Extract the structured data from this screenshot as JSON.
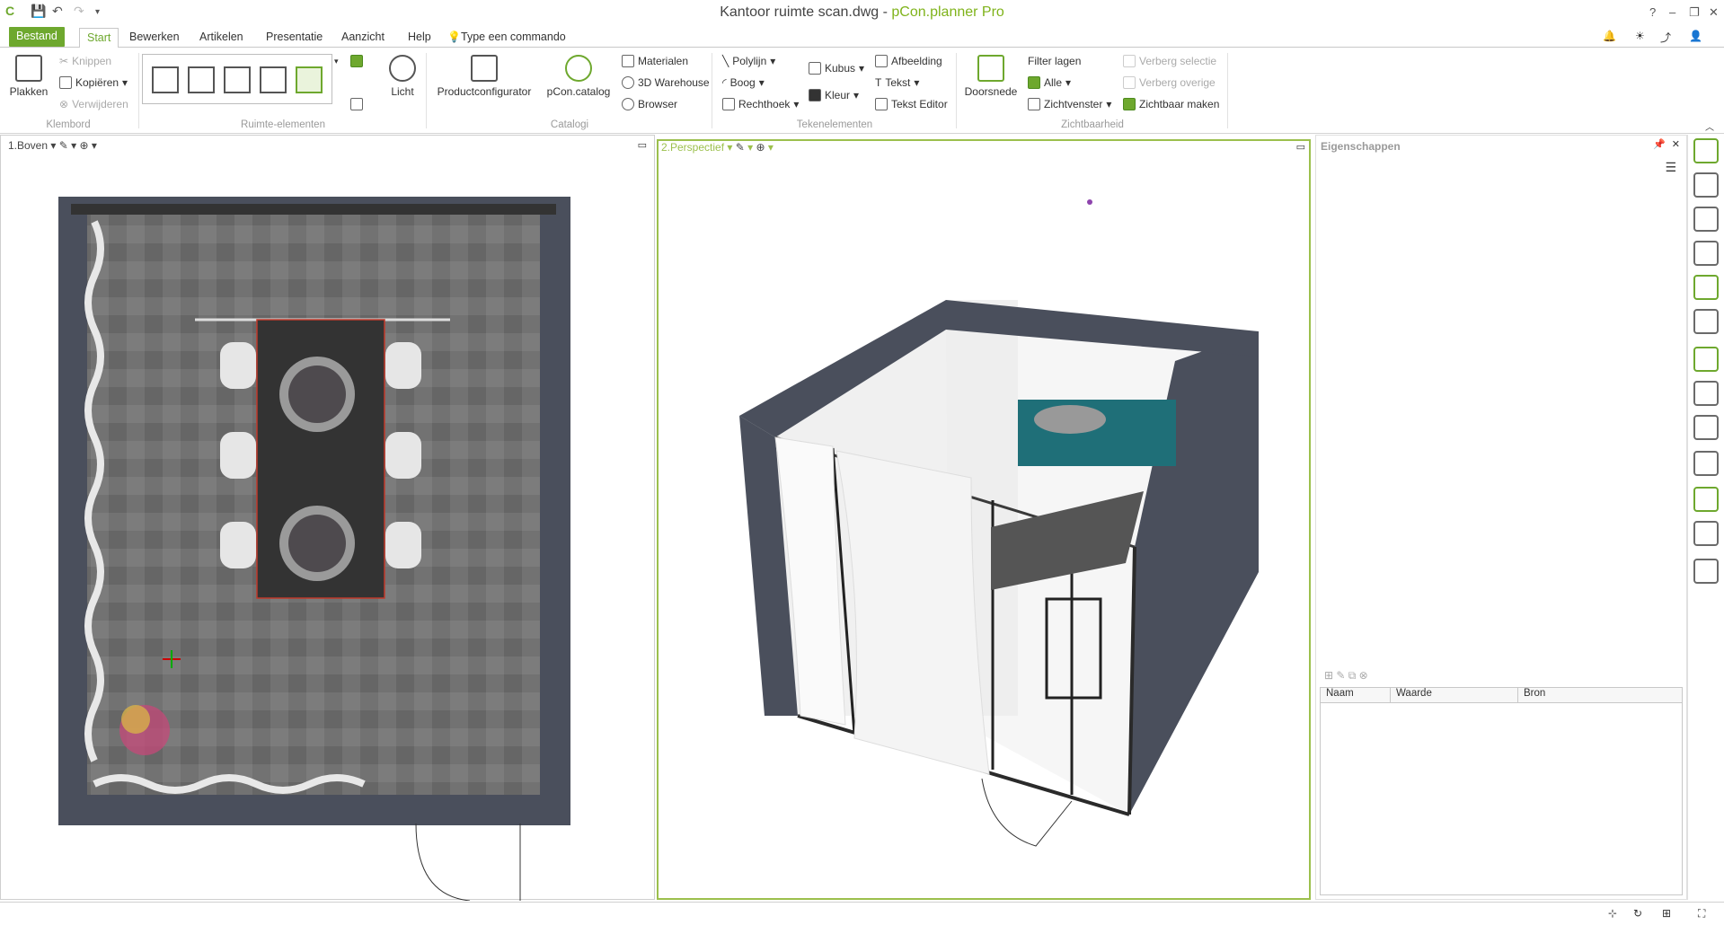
{
  "window": {
    "file_title": "Kantoor ruimte scan.dwg",
    "separator": " - ",
    "app_name": "pCon.planner Pro"
  },
  "titlebar_icons": [
    "help-icon",
    "minimize-icon",
    "restore-icon",
    "close-icon"
  ],
  "tabs": {
    "file": "Bestand",
    "start": "Start",
    "bewerken": "Bewerken",
    "artikelen": "Artikelen",
    "presentatie": "Presentatie",
    "aanzicht": "Aanzicht",
    "help": "Help"
  },
  "command_prompt": "Type een commando",
  "ribbon": {
    "klembord": {
      "paste": "Plakken",
      "cut": "Knippen",
      "copy": "Kopiëren",
      "delete": "Verwijderen",
      "group": "Klembord"
    },
    "ruimte": {
      "group": "Ruimte-elementen",
      "light": "Licht"
    },
    "catalogi": {
      "productconfigurator": "Productconfigurator",
      "pconcatalog": "pCon.catalog",
      "materials": "Materialen",
      "warehouse": "3D Warehouse",
      "browser": "Browser",
      "group": "Catalogi"
    },
    "teken": {
      "polyline": "Polylijn",
      "arc": "Boog",
      "rectangle": "Rechthoek",
      "cube": "Kubus",
      "color": "Kleur",
      "image": "Afbeelding",
      "text": "Tekst",
      "text_editor": "Tekst Editor",
      "group": "Tekenelementen"
    },
    "zicht": {
      "section": "Doorsnede",
      "filter": "Filter lagen",
      "all": "Alle",
      "window": "Zichtvenster",
      "hide_sel": "Verberg selectie",
      "hide_other": "Verberg overige",
      "make_visible": "Zichtbaar maken",
      "group": "Zichtbaarheid"
    }
  },
  "viewports": {
    "top": "1.Boven",
    "perspective": "2.Perspectief"
  },
  "properties": {
    "title": "Eigenschappen",
    "columns": [
      "Naam",
      "Waarde",
      "Bron"
    ]
  },
  "colors": {
    "accent": "#6ea82e",
    "wall": "#4a4f5c",
    "carpet": "#6e6e6e",
    "table": "#333333"
  }
}
